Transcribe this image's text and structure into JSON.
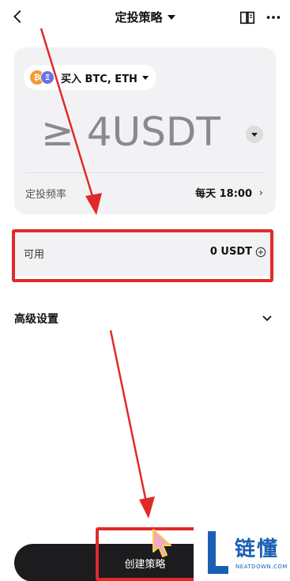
{
  "header": {
    "title": "定投策略",
    "back_icon": "chevron-left-icon",
    "book_icon": "book-icon",
    "more_icon": "more-horizontal-icon"
  },
  "strategy": {
    "asset_label": "买入 BTC, ETH",
    "coins": [
      "₿",
      "Ξ"
    ],
    "amount_text": "≥ 4USDT",
    "frequency_label": "定投频率",
    "frequency_value": "每天 18:00"
  },
  "available": {
    "label": "可用",
    "value": "0 USDT"
  },
  "advanced": {
    "label": "高级设置"
  },
  "footer": {
    "create_label": "创建策略"
  },
  "watermark": {
    "name": "链懂",
    "domain": "NEATDOWN.COM"
  },
  "colors": {
    "annotation_red": "#e02a2a",
    "btc": "#f39b35",
    "eth": "#6873e0",
    "button_bg": "#1c1c1e",
    "watermark_blue": "#1a5fb4"
  }
}
